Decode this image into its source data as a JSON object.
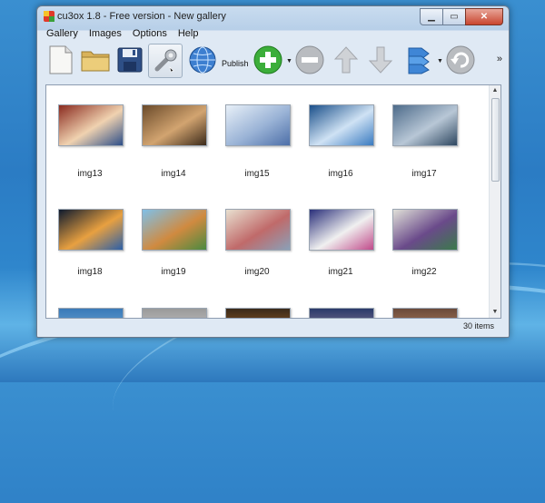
{
  "window": {
    "title": "cu3ox 1.8 - Free version - New gallery"
  },
  "window_controls": {
    "minimize": "▁",
    "maximize": "▭",
    "close": "✕"
  },
  "menu": [
    "Gallery",
    "Images",
    "Options",
    "Help"
  ],
  "toolbar": {
    "buttons": [
      {
        "name": "new-gallery-icon"
      },
      {
        "name": "open-folder-icon"
      },
      {
        "name": "save-icon"
      },
      {
        "name": "settings-wrench-icon"
      },
      {
        "name": "publish-globe-icon",
        "label": "Publish"
      },
      {
        "name": "add-images-icon"
      },
      {
        "name": "remove-images-icon"
      },
      {
        "name": "move-up-icon"
      },
      {
        "name": "move-down-icon"
      },
      {
        "name": "properties-icon"
      },
      {
        "name": "undo-icon"
      }
    ],
    "more": "»"
  },
  "gallery": {
    "images": [
      {
        "caption": "img13",
        "colors": [
          "#8a2a1f",
          "#f0d2b0",
          "#2d4e88"
        ]
      },
      {
        "caption": "img14",
        "colors": [
          "#6a4a2a",
          "#d2a470",
          "#3b2a1a"
        ]
      },
      {
        "caption": "img15",
        "colors": [
          "#e8f0f8",
          "#9ab3d6",
          "#4d6fa8"
        ]
      },
      {
        "caption": "img16",
        "colors": [
          "#1a4f8a",
          "#cfe2f4",
          "#3a7bc0"
        ]
      },
      {
        "caption": "img17",
        "colors": [
          "#4d6b8a",
          "#b8c7d6",
          "#2e4760"
        ]
      },
      {
        "caption": "img18",
        "colors": [
          "#0e1a2e",
          "#e8a040",
          "#2b5fa8"
        ]
      },
      {
        "caption": "img19",
        "colors": [
          "#7fc0e8",
          "#d08a40",
          "#4a8a40"
        ]
      },
      {
        "caption": "img20",
        "colors": [
          "#e8e0d0",
          "#c06a6a",
          "#8aa0b8"
        ]
      },
      {
        "caption": "img21",
        "colors": [
          "#2a2f7a",
          "#f0f0f0",
          "#c04a8a"
        ]
      },
      {
        "caption": "img22",
        "colors": [
          "#e0e0d8",
          "#6a4a8a",
          "#3a7a4a"
        ]
      },
      {
        "caption": "",
        "colors": [
          "#3a7ab8",
          "#8ac0e8"
        ]
      },
      {
        "caption": "",
        "colors": [
          "#9a9a9a",
          "#e0e0e0"
        ]
      },
      {
        "caption": "",
        "colors": [
          "#3a2a1a",
          "#d07a2a"
        ]
      },
      {
        "caption": "",
        "colors": [
          "#2a3a6a",
          "#c0a0b0"
        ]
      },
      {
        "caption": "",
        "colors": [
          "#6a4a3a",
          "#e0a070"
        ]
      }
    ]
  },
  "status": {
    "count": "30 items"
  }
}
